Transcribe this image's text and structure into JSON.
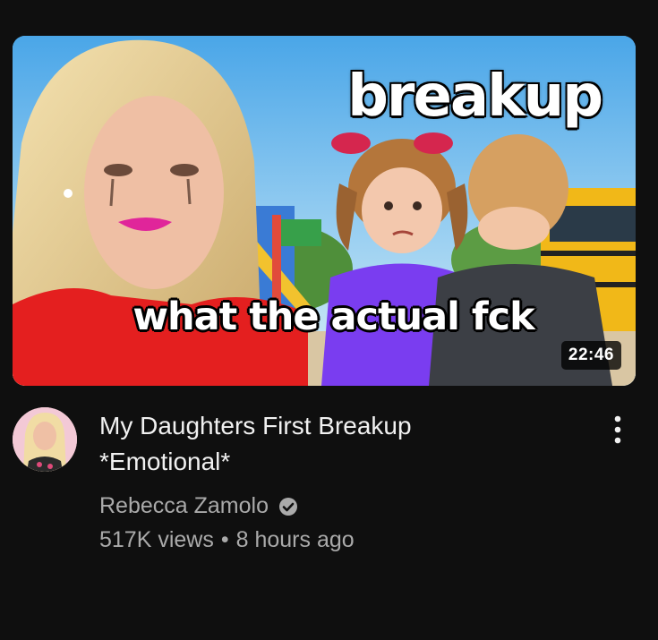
{
  "thumbnail": {
    "overlay_title": "breakup",
    "caption": "what the actual fck",
    "duration": "22:46"
  },
  "video": {
    "title_line1": "My Daughters First Breakup",
    "title_line2": "*Emotional*",
    "channel": "Rebecca Zamolo",
    "views": "517K views",
    "separator": "•",
    "age": "8 hours ago"
  },
  "icons": {
    "verified": "check-circle-icon",
    "menu": "kebab-menu-icon"
  },
  "colors": {
    "background": "#0f0f0f",
    "title_text": "#f1f1f1",
    "secondary_text": "#aaaaaa"
  }
}
